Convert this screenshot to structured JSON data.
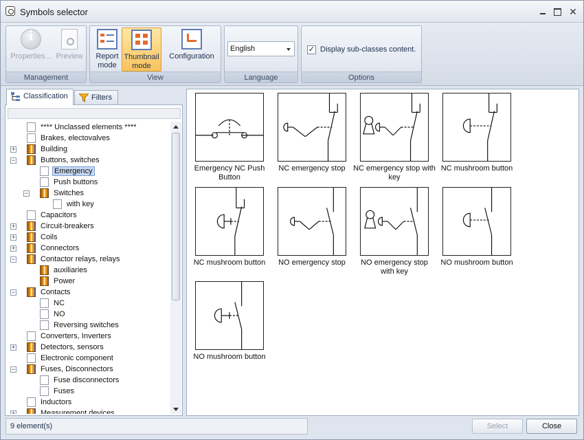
{
  "window": {
    "title": "Symbols selector"
  },
  "ribbon": {
    "groups": [
      {
        "label": "Management",
        "buttons": [
          {
            "label": "Properties...",
            "icon": "info-icon",
            "enabled": false
          },
          {
            "label": "Preview",
            "icon": "preview-icon",
            "enabled": false
          }
        ]
      },
      {
        "label": "View",
        "buttons": [
          {
            "label": "Report mode",
            "icon": "report-mode-icon",
            "active": false
          },
          {
            "label": "Thumbnail mode",
            "icon": "thumbnail-mode-icon",
            "active": true
          },
          {
            "label": "Configuration",
            "icon": "configuration-icon",
            "active": false
          }
        ]
      },
      {
        "label": "Language",
        "select_value": "English"
      },
      {
        "label": "Options",
        "checkbox_label": "Display sub-classes content.",
        "checked": true
      }
    ],
    "accent_color": "#f9c35e"
  },
  "left_panel": {
    "tabs": [
      {
        "label": "Classification",
        "selected": true
      },
      {
        "label": "Filters",
        "selected": false
      }
    ],
    "tree": [
      {
        "label": "**** Unclassed elements ****",
        "level": 0,
        "type": "doc"
      },
      {
        "label": "Brakes, electovalves",
        "level": 0,
        "type": "doc"
      },
      {
        "label": "Building",
        "level": 0,
        "type": "folder",
        "expander": "+"
      },
      {
        "label": "Buttons, switches",
        "level": 0,
        "type": "folder",
        "expander": "−"
      },
      {
        "label": "Emergency",
        "level": 1,
        "type": "doc",
        "selected": true
      },
      {
        "label": "Push buttons",
        "level": 1,
        "type": "doc"
      },
      {
        "label": "Switches",
        "level": 1,
        "type": "folder",
        "expander": "−"
      },
      {
        "label": "with key",
        "level": 2,
        "type": "doc"
      },
      {
        "label": "Capacitors",
        "level": 0,
        "type": "doc"
      },
      {
        "label": "Circuit-breakers",
        "level": 0,
        "type": "folder",
        "expander": "+"
      },
      {
        "label": "Coils",
        "level": 0,
        "type": "folder",
        "expander": "+"
      },
      {
        "label": "Connectors",
        "level": 0,
        "type": "folder",
        "expander": "+"
      },
      {
        "label": "Contactor relays, relays",
        "level": 0,
        "type": "folder",
        "expander": "−"
      },
      {
        "label": "auxiliaries",
        "level": 1,
        "type": "folder"
      },
      {
        "label": "Power",
        "level": 1,
        "type": "folder"
      },
      {
        "label": "Contacts",
        "level": 0,
        "type": "folder",
        "expander": "−"
      },
      {
        "label": "NC",
        "level": 1,
        "type": "doc"
      },
      {
        "label": "NO",
        "level": 1,
        "type": "doc"
      },
      {
        "label": "Reversing switches",
        "level": 1,
        "type": "doc"
      },
      {
        "label": "Converters, Inverters",
        "level": 0,
        "type": "doc"
      },
      {
        "label": "Detectors, sensors",
        "level": 0,
        "type": "folder",
        "expander": "+"
      },
      {
        "label": "Electronic component",
        "level": 0,
        "type": "doc"
      },
      {
        "label": "Fuses, Disconnectors",
        "level": 0,
        "type": "folder",
        "expander": "−"
      },
      {
        "label": "Fuse disconnectors",
        "level": 1,
        "type": "doc"
      },
      {
        "label": "Fuses",
        "level": 1,
        "type": "doc"
      },
      {
        "label": "Inductors",
        "level": 0,
        "type": "doc"
      },
      {
        "label": "Measurement devices",
        "level": 0,
        "type": "folder",
        "expander": "+"
      }
    ]
  },
  "thumbnails": [
    {
      "caption": "Emergency NC Push Button",
      "symbol": "nc-push"
    },
    {
      "caption": "NC emergency stop",
      "symbol": "nc-estop"
    },
    {
      "caption": "NC emergency stop with key",
      "symbol": "nc-estop-key"
    },
    {
      "caption": "NC mushroom button",
      "symbol": "nc-mushroom"
    },
    {
      "caption": "NC mushroom button",
      "symbol": "nc-mushroom-2"
    },
    {
      "caption": "NO emergency stop",
      "symbol": "no-estop"
    },
    {
      "caption": "NO emergency stop with key",
      "symbol": "no-estop-key"
    },
    {
      "caption": "NO mushroom button",
      "symbol": "no-mushroom"
    },
    {
      "caption": "NO mushroom button",
      "symbol": "no-mushroom-2"
    }
  ],
  "statusbar": {
    "text": "9 element(s)",
    "select_label": "Select",
    "close_label": "Close"
  }
}
